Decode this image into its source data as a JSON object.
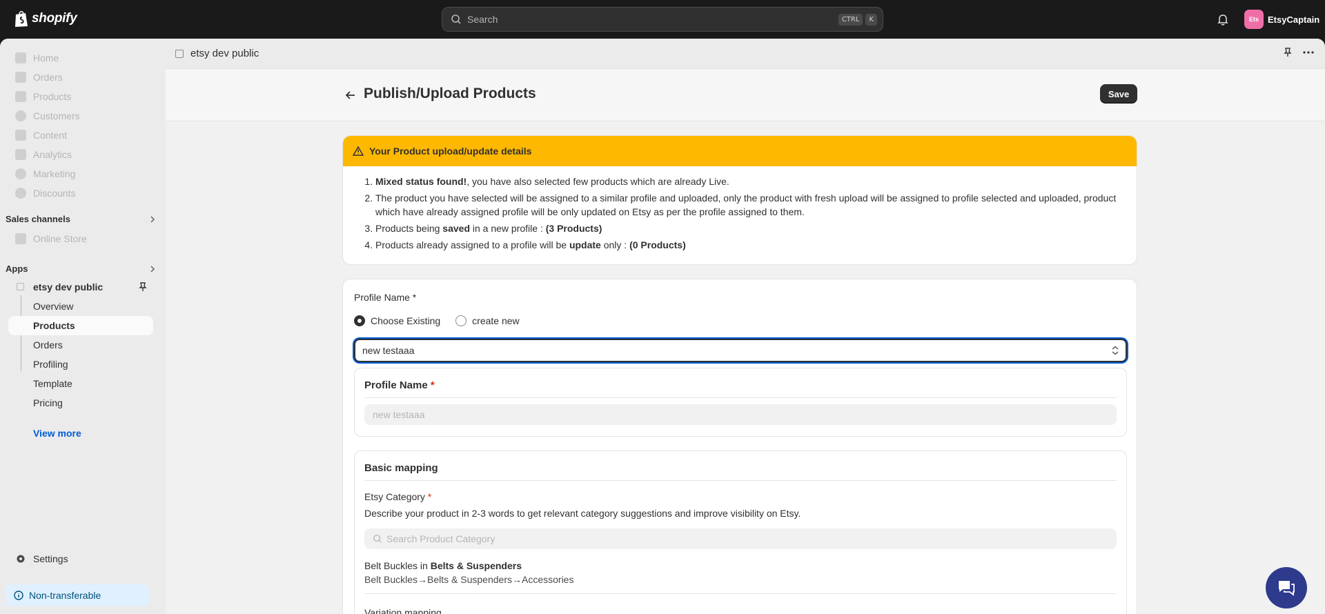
{
  "topbar": {
    "logo_text": "shopify",
    "search_placeholder": "Search",
    "shortcut_ctrl": "CTRL",
    "shortcut_key": "K",
    "user_initials": "Ets",
    "user_name": "EtsyCaptain"
  },
  "sidebar": {
    "items": [
      {
        "label": "Home",
        "icon": "home-icon"
      },
      {
        "label": "Orders",
        "icon": "orders-icon"
      },
      {
        "label": "Products",
        "icon": "tag-icon"
      },
      {
        "label": "Customers",
        "icon": "person-icon"
      },
      {
        "label": "Content",
        "icon": "content-icon"
      },
      {
        "label": "Analytics",
        "icon": "chart-icon"
      },
      {
        "label": "Marketing",
        "icon": "target-icon"
      },
      {
        "label": "Discounts",
        "icon": "discount-icon"
      }
    ],
    "sales_channels_label": "Sales channels",
    "online_store_label": "Online Store",
    "apps_label": "Apps",
    "app_name": "etsy dev public",
    "app_items": [
      "Overview",
      "Products",
      "Orders",
      "Profiling",
      "Template",
      "Pricing"
    ],
    "view_more": "View more",
    "settings": "Settings",
    "non_transferable": "Non-transferable"
  },
  "header": {
    "app_name": "etsy dev public"
  },
  "page": {
    "title": "Publish/Upload Products",
    "save_label": "Save"
  },
  "banner": {
    "title": "Your Product upload/update details",
    "line1_bold": "Mixed status found!",
    "line1_rest": ", you have also selected few products which are already Live.",
    "line2": "The product you have selected will be assigned to a similar profile and uploaded, only the product with fresh upload will be assigned to profile selected and uploaded, product which have already assigned profile will be only updated on Etsy as per the profile assigned to them.",
    "line3_a": "Products being ",
    "line3_bold": "saved",
    "line3_b": " in a new profile : ",
    "line3_count": "(3 Products)",
    "line4_a": "Products already assigned to a profile will be ",
    "line4_bold": "update",
    "line4_b": " only : ",
    "line4_count": "(0 Products)"
  },
  "form": {
    "profile_name_label": "Profile Name *",
    "radio_existing": "Choose Existing",
    "radio_new": "create new",
    "selected_profile": "new testaaa",
    "profile_section_title": "Profile Name",
    "required_mark": "*",
    "profile_name_value": "new testaaa",
    "basic_mapping_title": "Basic mapping",
    "etsy_category_label": "Etsy Category",
    "etsy_category_help": "Describe your product in 2-3 words to get relevant category suggestions and improve visibility on Etsy.",
    "category_search_placeholder": "Search Product Category",
    "suggestion_prefix": "Belt Buckles in ",
    "suggestion_bold": "Belts & Suspenders",
    "suggestion_path": "Belt Buckles→Belts & Suspenders→Accessories",
    "variation_mapping": "Variation mapping"
  }
}
